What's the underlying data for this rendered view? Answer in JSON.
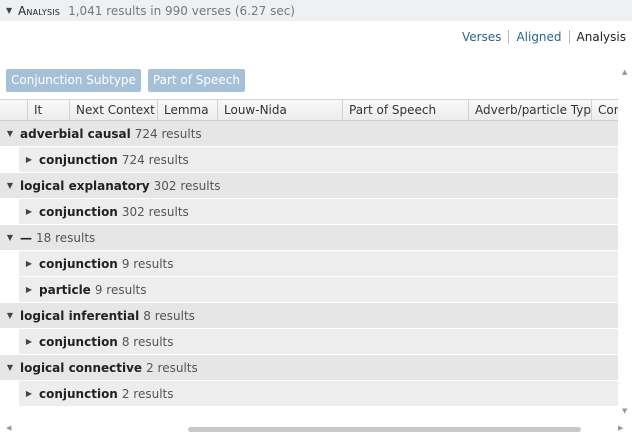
{
  "header": {
    "title": "Analysis",
    "summary": "1,041 results in 990 verses (6.27 sec)"
  },
  "view_tabs": [
    {
      "label": "Verses"
    },
    {
      "label": "Aligned"
    },
    {
      "label": "Analysis"
    }
  ],
  "group_pills": [
    {
      "label": "Conjunction Subtype"
    },
    {
      "label": "Part of Speech"
    }
  ],
  "columns": [
    {
      "label": ""
    },
    {
      "label": "It"
    },
    {
      "label": "Next Context"
    },
    {
      "label": "Lemma"
    },
    {
      "label": "Louw-Nida"
    },
    {
      "label": "Part of Speech"
    },
    {
      "label": "Adverb/particle Type"
    },
    {
      "label": "Con"
    }
  ],
  "rows": [
    {
      "label": "adverbial causal",
      "count": "724 results",
      "expanded": true
    },
    {
      "label": "conjunction",
      "count": "724 results",
      "expanded": false
    },
    {
      "label": "logical explanatory",
      "count": "302 results",
      "expanded": true
    },
    {
      "label": "conjunction",
      "count": "302 results",
      "expanded": false
    },
    {
      "label": "—",
      "count": "18 results",
      "expanded": true
    },
    {
      "label": "conjunction",
      "count": "9 results",
      "expanded": false
    },
    {
      "label": "particle",
      "count": "9 results",
      "expanded": false
    },
    {
      "label": "logical inferential",
      "count": "8 results",
      "expanded": true
    },
    {
      "label": "conjunction",
      "count": "8 results",
      "expanded": false
    },
    {
      "label": "logical connective",
      "count": "2 results",
      "expanded": true
    },
    {
      "label": "conjunction",
      "count": "2 results",
      "expanded": false
    }
  ],
  "icons": {
    "expanded": "triangle-down-icon",
    "collapsed": "triangle-right-icon"
  }
}
